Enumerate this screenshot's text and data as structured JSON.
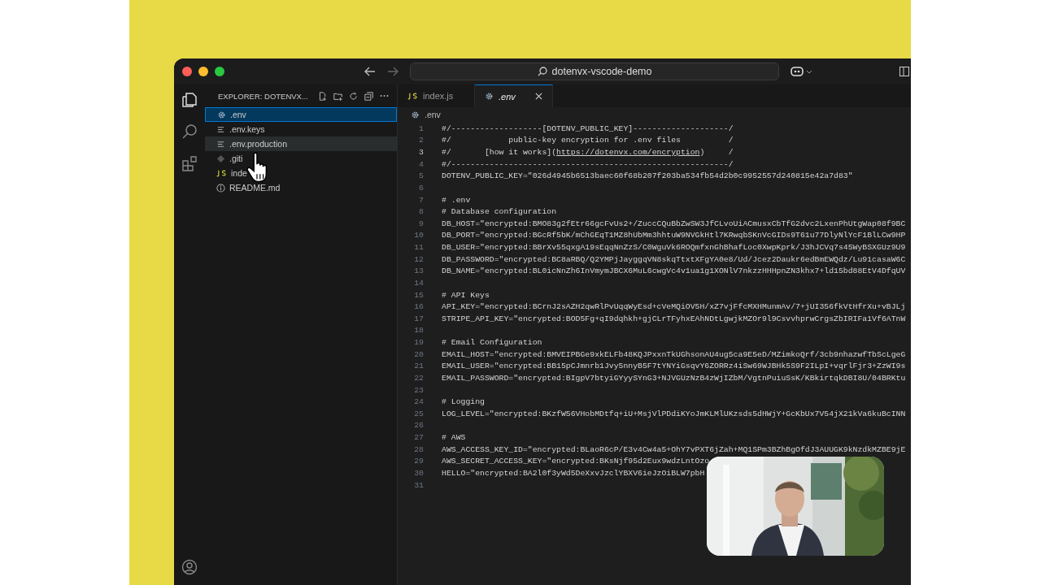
{
  "window": {
    "search_title": "dotenvx-vscode-demo"
  },
  "sidebar": {
    "title": "EXPLORER: DOTENVX...",
    "items": [
      {
        "label": ".env",
        "kind": "gear",
        "selected": true,
        "hovered": false
      },
      {
        "label": ".env.keys",
        "kind": "lines",
        "selected": false,
        "hovered": false
      },
      {
        "label": ".env.production",
        "kind": "lines",
        "selected": false,
        "hovered": true
      },
      {
        "label": ".giti",
        "kind": "diamond",
        "selected": false,
        "hovered": false
      },
      {
        "label": "inde",
        "kind": "js",
        "selected": false,
        "hovered": false
      },
      {
        "label": "README.md",
        "kind": "info",
        "selected": false,
        "hovered": false
      }
    ]
  },
  "tabs": [
    {
      "label": "index.js",
      "kind": "js",
      "selected": false,
      "preview": false
    },
    {
      "label": ".env",
      "kind": "gear",
      "selected": true,
      "preview": true
    }
  ],
  "breadcrumb": ".env",
  "editor": {
    "lines": [
      {
        "number": "1",
        "current": false,
        "text": "#/-------------------[DOTENV_PUBLIC_KEY]--------------------/"
      },
      {
        "number": "2",
        "current": false,
        "text": "#/            public-key encryption for .env files          /"
      },
      {
        "number": "3",
        "current": true,
        "text": "#/       [how it works](",
        "link": "https://dotenvx.com/encryption",
        "after": ")     /"
      },
      {
        "number": "4",
        "current": false,
        "text": "#/----------------------------------------------------------/"
      },
      {
        "number": "5",
        "current": false,
        "text": "DOTENV_PUBLIC_KEY=\"026d4945b6513baec60f68b207f203ba534fb54d2b0c9952557d240815e42a7d83\""
      },
      {
        "number": "6",
        "current": false
      },
      {
        "number": "7",
        "current": false,
        "text": "# .env"
      },
      {
        "number": "8",
        "current": false,
        "text": "# Database configuration"
      },
      {
        "number": "9",
        "current": false,
        "text": "DB_HOST=\"encrypted:BMO83g2fEtr66gcFvUs2+/ZuccCQuBbZwSW3JfCLvoUiACmusxCbTfG2dvc2LxenPhUtgWap08f9BC"
      },
      {
        "number": "10",
        "current": false,
        "text": "DB_PORT=\"encrypted:BGcRf5bK/mChGEqT1MZ8hUbMm3hhtuW9NVGkHtl7KRwqbSKnVcGIDs9T61u77DlyNlYcF1BlLCw9HP"
      },
      {
        "number": "11",
        "current": false,
        "text": "DB_USER=\"encrypted:BBrXv55qxgA19sEqqNnZzS/C0WguVk6ROQmfxnGhBhafLoc0XwpKprk/J3hJCVq7s45WyBSXGUz9U9"
      },
      {
        "number": "12",
        "current": false,
        "text": "DB_PASSWORD=\"encrypted:BC8aRBQ/Q2YMPjJayggqVN8skqTtxtXFgYA0e8/Ud/Jcez2Daukr6edBmEWQdz/Lu91casaW6C"
      },
      {
        "number": "13",
        "current": false,
        "text": "DB_NAME=\"encrypted:BL0icNnZh6InVmymJBCX6MuL6cwgVc4v1ua1g1XONlV7nkzzHHHpnZN3khx7+ld15bd88EtV4DfqUV"
      },
      {
        "number": "14",
        "current": false
      },
      {
        "number": "15",
        "current": false,
        "text": "# API Keys"
      },
      {
        "number": "16",
        "current": false,
        "text": "API_KEY=\"encrypted:BCrnJ2sAZH2qwRlPvUqqWyEsd+cVeMQiOV5H/xZ7vjFfcMXHMunmAv/7+jUI356fkVtHfrXu+vBJLj"
      },
      {
        "number": "17",
        "current": false,
        "text": "STRIPE_API_KEY=\"encrypted:BOD5Fg+qI9dqhkh+gjCLrTFyhxEAhNDtLgwjkMZOr9l9CsvvhprwCrgsZbIRIFa1Vf6ATnW"
      },
      {
        "number": "18",
        "current": false
      },
      {
        "number": "19",
        "current": false,
        "text": "# Email Configuration"
      },
      {
        "number": "20",
        "current": false,
        "text": "EMAIL_HOST=\"encrypted:BMVEIPBGe9xkELFb48KQJPxxnTkUGhsonAU4ug5ca9E5eD/MZimkoQrf/3cb9nhazwfTbScLgeG"
      },
      {
        "number": "21",
        "current": false,
        "text": "EMAIL_USER=\"encrypted:BB15pCJmnrb1Jvy5nnyB5F7tYNYiGsqvY6ZORRz4iSw69WJBHk5S9F2ILpI+vqrlFjr3+ZzWI9s"
      },
      {
        "number": "22",
        "current": false,
        "text": "EMAIL_PASSWORD=\"encrypted:BIgpV7btyiGYyySYnG3+NJVGUzNzB4zWjIZbM/VgtnPuiuSsK/KBkirtqkDBI8U/04BRKtu"
      },
      {
        "number": "23",
        "current": false
      },
      {
        "number": "24",
        "current": false,
        "text": "# Logging"
      },
      {
        "number": "25",
        "current": false,
        "text": "LOG_LEVEL=\"encrypted:BKzfW56VHobMDtfq+iU+MsjVlPDdiKYoJmKLMlUKzsds5dHWjY+GcKbUx7V54jX21kVa6kuBcINN"
      },
      {
        "number": "26",
        "current": false
      },
      {
        "number": "27",
        "current": false,
        "text": "# AWS"
      },
      {
        "number": "28",
        "current": false,
        "text": "AWS_ACCESS_KEY_ID=\"encrypted:BLaoR6cP/E3v4Cw4a5+OhY7vPXT6jZah+MQ1SPm3BZhBgOfdJ3AUUGK9kNzdkMZBE9jE"
      },
      {
        "number": "29",
        "current": false,
        "text": "AWS_SECRET_ACCESS_KEY=\"encrypted:BKsNjf95d2Eux9wdzLntOzo"
      },
      {
        "number": "30",
        "current": false,
        "text": "HELLO=\"encrypted:BA2l0f3yWd5DeXxvJzclYBXV6ieJzOiBLW7pbH"
      },
      {
        "number": "31",
        "current": false
      }
    ]
  }
}
